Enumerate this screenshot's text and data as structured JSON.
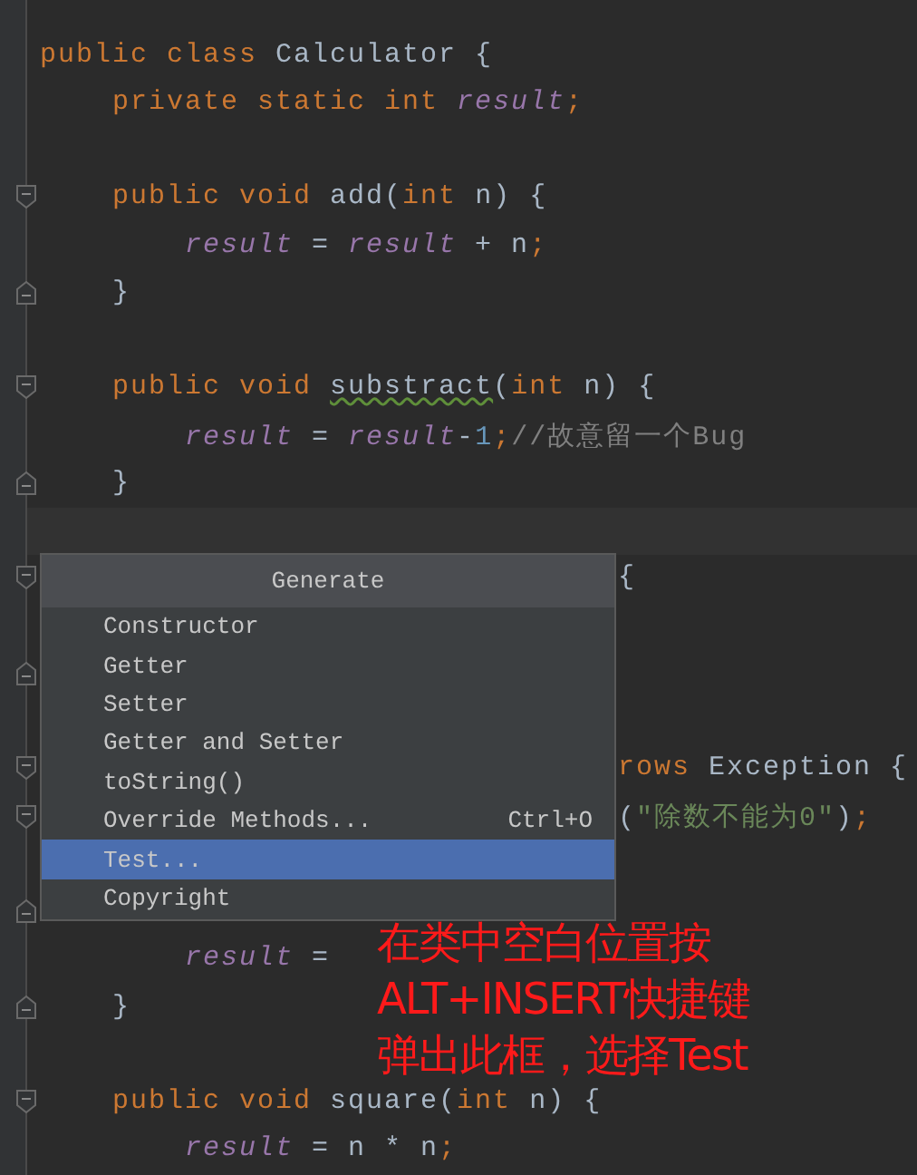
{
  "editor": {
    "lines": [
      {
        "kind": "top",
        "tokens": [
          {
            "kind": "keyword",
            "text": "public class "
          },
          {
            "kind": "plain",
            "text": "Calculator {"
          }
        ]
      },
      {
        "kind": "member",
        "tokens": [
          {
            "kind": "keyword",
            "text": "private static int "
          },
          {
            "kind": "field",
            "text": "result"
          },
          {
            "kind": "keyword",
            "text": ";"
          }
        ]
      },
      {
        "kind": "blank"
      },
      {
        "kind": "member",
        "fold": {
          "kind": "start"
        },
        "tokens": [
          {
            "kind": "keyword",
            "text": "public void "
          },
          {
            "kind": "plain",
            "text": "add("
          },
          {
            "kind": "keyword",
            "text": "int "
          },
          {
            "kind": "plain",
            "text": "n) {"
          }
        ]
      },
      {
        "kind": "body",
        "tokens": [
          {
            "kind": "field",
            "text": "result"
          },
          {
            "kind": "plain",
            "text": " = "
          },
          {
            "kind": "field",
            "text": "result"
          },
          {
            "kind": "plain",
            "text": " + n"
          },
          {
            "kind": "keyword",
            "text": ";"
          }
        ]
      },
      {
        "kind": "member",
        "fold": {
          "kind": "end"
        },
        "tokens": [
          {
            "kind": "plain",
            "text": "}"
          }
        ]
      },
      {
        "kind": "blank"
      },
      {
        "kind": "member",
        "fold": {
          "kind": "start"
        },
        "tokens": [
          {
            "kind": "keyword",
            "text": "public void "
          },
          {
            "kind": "warning",
            "text": "substract"
          },
          {
            "kind": "plain",
            "text": "("
          },
          {
            "kind": "keyword",
            "text": "int "
          },
          {
            "kind": "plain",
            "text": "n) {"
          }
        ]
      },
      {
        "kind": "body",
        "tokens": [
          {
            "kind": "field",
            "text": "result"
          },
          {
            "kind": "plain",
            "text": " = "
          },
          {
            "kind": "field",
            "text": "result"
          },
          {
            "kind": "plain",
            "text": "-"
          },
          {
            "kind": "number",
            "text": "1"
          },
          {
            "kind": "keyword",
            "text": ";"
          },
          {
            "kind": "comment",
            "text": "//故意留一个Bug"
          }
        ]
      },
      {
        "kind": "member",
        "fold": {
          "kind": "end"
        },
        "tokens": [
          {
            "kind": "plain",
            "text": "}"
          }
        ]
      },
      {
        "kind": "blank",
        "current": true
      },
      {
        "kind": "popup",
        "fold": {
          "kind": "start"
        },
        "tokens": [
          {
            "kind": "plain",
            "text": "{"
          }
        ]
      },
      {
        "kind": "blank"
      },
      {
        "kind": "blank",
        "fold": {
          "kind": "end"
        }
      },
      {
        "kind": "blank"
      },
      {
        "kind": "popup",
        "fold": {
          "kind": "start"
        },
        "tokens": [
          {
            "kind": "keyword",
            "text": "rows "
          },
          {
            "kind": "plain",
            "text": "Exception {"
          }
        ]
      },
      {
        "kind": "popup",
        "fold": {
          "kind": "start"
        },
        "tokens": [
          {
            "kind": "plain",
            "text": "("
          },
          {
            "kind": "string",
            "text": "\"除数不能为0\""
          },
          {
            "kind": "plain",
            "text": ")"
          },
          {
            "kind": "keyword",
            "text": ";"
          }
        ]
      },
      {
        "kind": "blank"
      },
      {
        "kind": "blank",
        "fold": {
          "kind": "end"
        }
      },
      {
        "kind": "body",
        "tokens": [
          {
            "kind": "field",
            "text": "result"
          },
          {
            "kind": "plain",
            "text": " ="
          }
        ]
      },
      {
        "kind": "member",
        "fold": {
          "kind": "end"
        },
        "tokens": [
          {
            "kind": "plain",
            "text": "}"
          }
        ]
      },
      {
        "kind": "blank"
      },
      {
        "kind": "member",
        "fold": {
          "kind": "start"
        },
        "tokens": [
          {
            "kind": "keyword",
            "text": "public void "
          },
          {
            "kind": "plain",
            "text": "square("
          },
          {
            "kind": "keyword",
            "text": "int "
          },
          {
            "kind": "plain",
            "text": "n) {"
          }
        ]
      },
      {
        "kind": "body",
        "tokens": [
          {
            "kind": "field",
            "text": "result"
          },
          {
            "kind": "plain",
            "text": " = n * n"
          },
          {
            "kind": "keyword",
            "text": ";"
          }
        ]
      }
    ]
  },
  "generate_menu": {
    "title": "Generate",
    "items": [
      {
        "label": "Constructor",
        "selected": false
      },
      {
        "label": "Getter",
        "selected": false
      },
      {
        "label": "Setter",
        "selected": false
      },
      {
        "label": "Getter and Setter",
        "selected": false
      },
      {
        "label": "toString()",
        "selected": false
      },
      {
        "label": "Override Methods...",
        "shortcut": "Ctrl+O",
        "selected": false
      },
      {
        "label": "Test...",
        "selected": true
      },
      {
        "label": "Copyright",
        "selected": false
      }
    ]
  },
  "annotation": {
    "lines": [
      "在类中空白位置按",
      "ALT+INSERT快捷键",
      "弹出此框，选择Test"
    ]
  }
}
